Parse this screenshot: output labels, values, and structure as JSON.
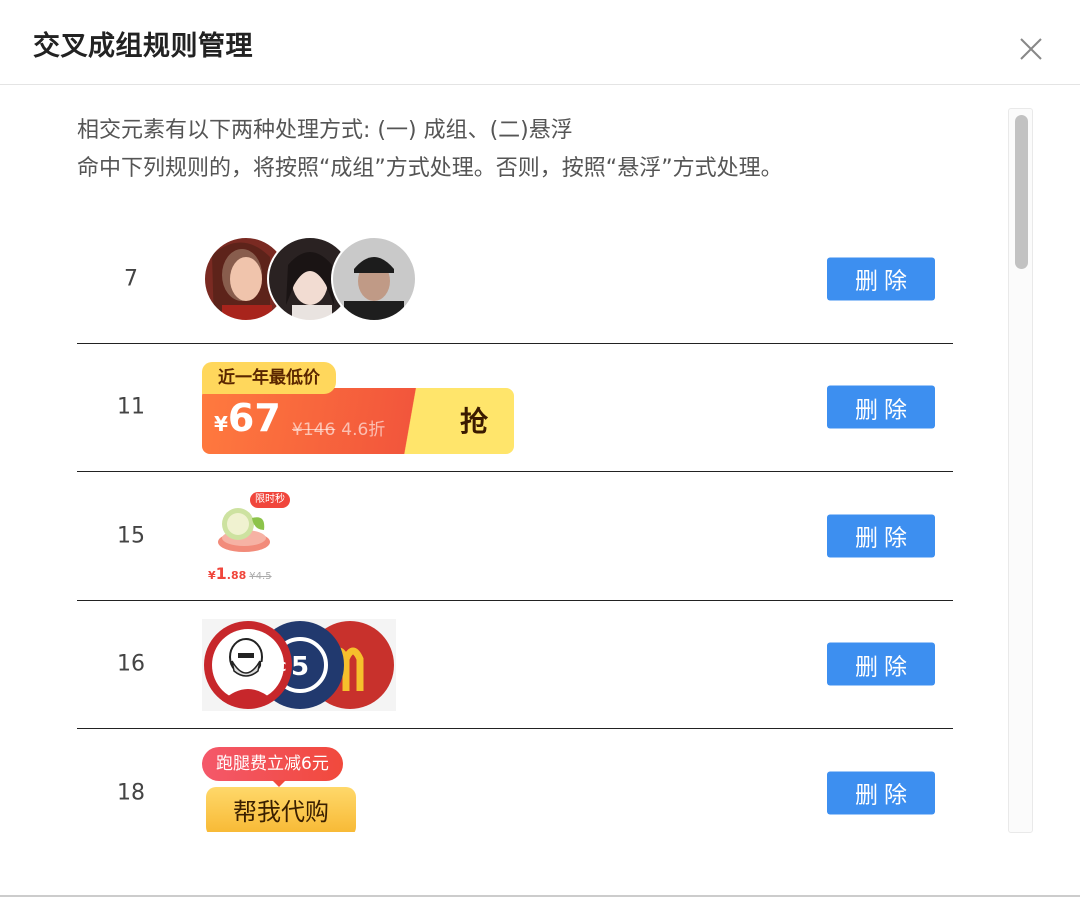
{
  "dialog": {
    "title": "交叉成组规则管理",
    "close_icon": "close-icon"
  },
  "description": {
    "line1": "相交元素有以下两种处理方式: (一) 成组、(二)悬浮",
    "line2": "命中下列规则的，将按照“成组”方式处理。否则，按照“悬浮”方式处理。"
  },
  "delete_label": "删除",
  "rules": [
    {
      "id": "7",
      "image": "avatar-group"
    },
    {
      "id": "11",
      "image": "lowest-price-badge",
      "tag": "近一年最低价",
      "currency": "¥",
      "price": "67",
      "old_price": "¥146",
      "discount": "4.6折",
      "action": "抢"
    },
    {
      "id": "15",
      "image": "flash-sale-item",
      "badge": "限时秒",
      "currency": "¥",
      "price": "1",
      "price_decimal": ".88",
      "old_price": "¥4.5"
    },
    {
      "id": "16",
      "image": "brand-logo-group",
      "brand_text": "KFC"
    },
    {
      "id": "18",
      "image": "errand-buy-button",
      "tag": "跑腿费立减6元",
      "button": "帮我代购"
    }
  ],
  "colors": {
    "primary": "#3d8ff0",
    "divider": "#222222",
    "promo_orange": "#f2563c",
    "promo_yellow": "#ffd75c"
  }
}
